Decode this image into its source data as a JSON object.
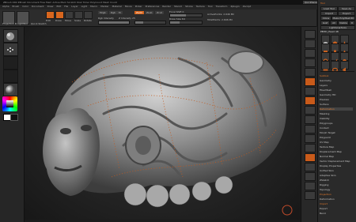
{
  "app": {
    "title": "ZBrush 4R2  ZBrush Document  Free Mem  Active Mem  Scratch Disk  Timer  PolyCount  Mesh Count",
    "quick_buttons": [
      "QuickSave",
      "See-through 0",
      "Menus"
    ]
  },
  "menus": [
    "Alpha",
    "Brush",
    "Color",
    "Document",
    "Draw",
    "Edit",
    "File",
    "Layer",
    "Light",
    "Macro",
    "Marker",
    "Material",
    "Movie",
    "Picker",
    "Preferences",
    "Render",
    "Stencil",
    "Stroke",
    "Texture",
    "Tool",
    "Transform",
    "Zplugin",
    "Zscript"
  ],
  "shelf": {
    "projection_label": "Projection Master",
    "lightbox_label": "LightBox",
    "quick_sketch_label": "Quick Sketch",
    "edit_label": "Edit",
    "draw_label": "Draw",
    "move_label": "Move",
    "scale_label": "Scale",
    "rotate_label": "Rotate",
    "mrgb_label": "Mrgb",
    "rgb_label": "Rgb",
    "m_label": "M",
    "rgb_intensity_label": "Rgb Intensity",
    "zadd_label": "Zadd",
    "zsub_label": "Zsub",
    "zcut_label": "Zcut",
    "focal_shift": {
      "label": "Focal Shift",
      "value": 0,
      "level": 0.5
    },
    "draw_size": {
      "label": "Draw Size",
      "value": 64,
      "level": 0.3
    },
    "z_intensity": {
      "label": "Z Intensity",
      "value": 25,
      "level": 0.25
    },
    "active_points": "ActivePoints: 2.646 Mil",
    "total_points": "TotalPoints: 2.646 Mil"
  },
  "tool_panel": {
    "title": "Tool",
    "load_tool": "Load Tool",
    "save_as": "Save As",
    "import": "Import",
    "export": "Export",
    "clone": "Clone",
    "make_polymesh": "Make PolyMesh3D",
    "goz": "GoZ",
    "all": "All",
    "visible": "Visible",
    "r": "R",
    "lightbox_tools": "Lightbox▸Tools",
    "current_tool": "PM3D_Head 48",
    "subtools": [
      {
        "label": "Subtool",
        "accent": true,
        "selected": false
      },
      {
        "label": "Geometry",
        "accent": false,
        "selected": false
      },
      {
        "label": "Layers",
        "accent": false,
        "selected": false
      },
      {
        "label": "FiberMesh",
        "accent": false,
        "selected": false
      },
      {
        "label": "Geometry HD",
        "accent": false,
        "selected": false
      },
      {
        "label": "Preview",
        "accent": false,
        "selected": false
      },
      {
        "label": "Surface",
        "accent": false,
        "selected": false
      },
      {
        "label": "Deformation",
        "accent": true,
        "selected": true
      },
      {
        "label": "Masking",
        "accent": false,
        "selected": false
      },
      {
        "label": "Visibility",
        "accent": false,
        "selected": false
      },
      {
        "label": "Polygroups",
        "accent": false,
        "selected": false
      },
      {
        "label": "Contact",
        "accent": false,
        "selected": false
      },
      {
        "label": "Morph Target",
        "accent": false,
        "selected": false
      },
      {
        "label": "Polypaint",
        "accent": false,
        "selected": false
      },
      {
        "label": "UV Map",
        "accent": false,
        "selected": false
      },
      {
        "label": "Texture Map",
        "accent": false,
        "selected": false
      },
      {
        "label": "Displacement Map",
        "accent": false,
        "selected": false
      },
      {
        "label": "Normal Map",
        "accent": false,
        "selected": false
      },
      {
        "label": "Vector Displacement Map",
        "accent": false,
        "selected": false
      },
      {
        "label": "Display Properties",
        "accent": false,
        "selected": false
      },
      {
        "label": "Unified Skin",
        "accent": false,
        "selected": false
      },
      {
        "label": "Adaptive Skin",
        "accent": false,
        "selected": false
      },
      {
        "label": "ZSketch",
        "accent": false,
        "selected": false
      },
      {
        "label": "Rigging",
        "accent": false,
        "selected": false
      },
      {
        "label": "Topology",
        "accent": false,
        "selected": false
      },
      {
        "label": "Projection",
        "accent": true,
        "selected": false
      },
      {
        "label": "Deformation",
        "accent": false,
        "selected": false
      },
      {
        "label": "Import",
        "accent": true,
        "selected": false
      },
      {
        "label": "Export",
        "accent": false,
        "selected": false
      },
      {
        "label": "Bend",
        "accent": false,
        "selected": false
      }
    ]
  },
  "colors": {
    "accent": "#e0701f",
    "panel": "#2a2a2a",
    "canvas": "#252525"
  }
}
